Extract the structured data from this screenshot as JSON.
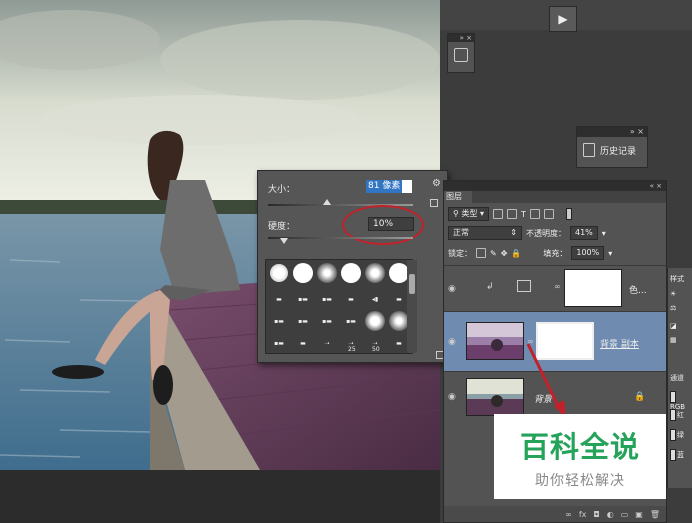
{
  "brush_popup": {
    "size_label": "大小：",
    "size_value": "81 像素",
    "hardness_label": "硬度：",
    "hardness_value": "10%",
    "preset_labels": [
      "25",
      "50"
    ]
  },
  "history_panel": {
    "label": "历史记录"
  },
  "layers_panel": {
    "tab_label": "图层",
    "filter_type": "类型",
    "blend_mode": "正常",
    "opacity_label": "不透明度：",
    "opacity_value": "41%",
    "lock_label": "锁定：",
    "fill_label": "填充：",
    "fill_value": "100%",
    "layers": [
      {
        "name": "色..."
      },
      {
        "name": "背景 副本"
      },
      {
        "name": "背景"
      }
    ]
  },
  "channels_panel": {
    "tab_label": "通道",
    "items": [
      "RGB",
      "红",
      "绿",
      "蓝"
    ]
  },
  "styles_tab": "样式",
  "watermark": {
    "title": "百科全说",
    "subtitle": "助你轻松解决"
  },
  "colors": {
    "highlight_ellipse": "#c3212a",
    "watermark_green": "#25a35a",
    "selection_blue": "#3276c3"
  }
}
